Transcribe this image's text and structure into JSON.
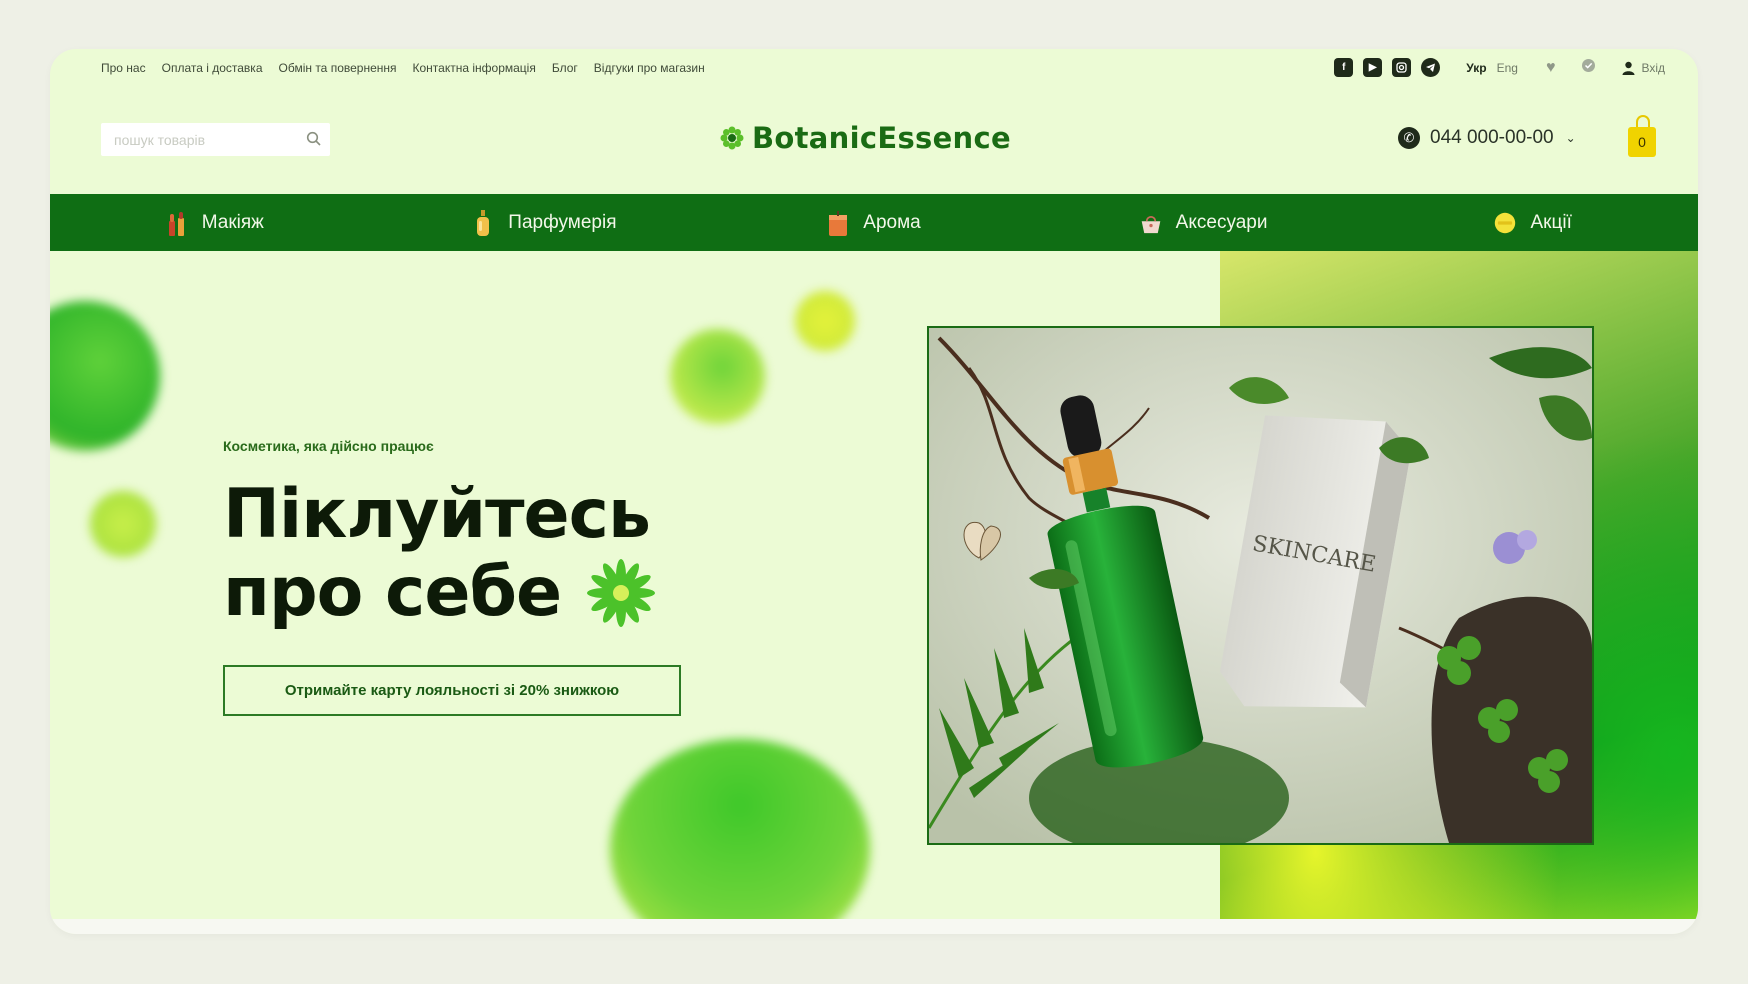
{
  "topbar": {
    "links": [
      "Про нас",
      "Оплата і доставка",
      "Обмін та повернення",
      "Контактна інформація",
      "Блог",
      "Відгуки про магазин"
    ],
    "social": [
      "facebook-icon",
      "youtube-icon",
      "instagram-icon",
      "telegram-icon"
    ],
    "lang_active": "Укр",
    "lang_other": "Eng",
    "login_label": "Вхід"
  },
  "header": {
    "search_placeholder": "пошук товарів",
    "logo_text": "BotanicEssence",
    "phone": "044 000-00-00",
    "cart_count": "0"
  },
  "nav": {
    "items": [
      {
        "label": "Макіяж",
        "icon": "lipstick-icon"
      },
      {
        "label": "Парфумерія",
        "icon": "perfume-icon"
      },
      {
        "label": "Арома",
        "icon": "candle-icon"
      },
      {
        "label": "Аксесуари",
        "icon": "bag-icon"
      },
      {
        "label": "Акції",
        "icon": "sale-icon"
      }
    ]
  },
  "hero": {
    "tagline": "Косметика, яка дійсно працює",
    "headline_line1": "Піклуйтесь",
    "headline_line2": "про себе",
    "cta_label": "Отримайте карту лояльності зі 20% знижкою",
    "product_text": "SKINCARE"
  },
  "colors": {
    "brand_green": "#0f6e14",
    "background": "#ecfbd5",
    "accent_yellow": "#f0d300"
  }
}
